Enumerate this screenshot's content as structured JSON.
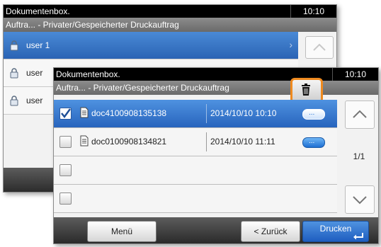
{
  "back_screen": {
    "title": "Dokumentenbox.",
    "time": "10:10",
    "subtitle": "Auftra... - Privater/Gespeicherter Druckauftrag",
    "users": [
      {
        "label": "user 1",
        "selected": true
      },
      {
        "label": "user",
        "selected": false
      },
      {
        "label": "user",
        "selected": false
      }
    ]
  },
  "front_screen": {
    "title": "Dokumentenbox.",
    "time": "10:10",
    "subtitle": "Auftra... - Privater/Gespeicherter Druckauftrag",
    "rows": [
      {
        "name": "doc4100908135138",
        "date": "2014/10/10 10:10",
        "checked": true,
        "selected": true
      },
      {
        "name": "doc0100908134821",
        "date": "2014/10/10 11:11",
        "checked": false,
        "selected": false
      },
      {
        "name": "",
        "date": "",
        "checked": false,
        "selected": false
      },
      {
        "name": "",
        "date": "",
        "checked": false,
        "selected": false
      }
    ],
    "details_label": "...",
    "page_indicator": "1/1",
    "icons": {
      "delete": "trash-icon",
      "document": "document-icon",
      "lock": "lock-icon"
    },
    "footer": {
      "menu": "Menü",
      "back": "< Zurück",
      "print": "Drucken"
    }
  },
  "colors": {
    "selected": "#2a68c0",
    "highlight_border": "#ef8a1f"
  }
}
